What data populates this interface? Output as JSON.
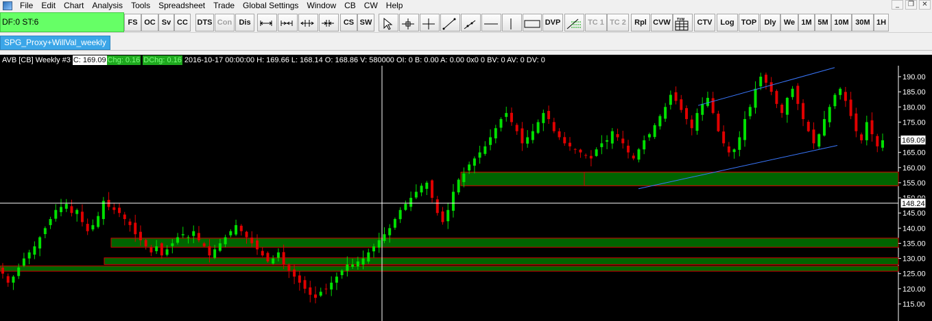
{
  "menu": [
    "File",
    "Edit",
    "Chart",
    "Analysis",
    "Tools",
    "Spreadsheet",
    "Trade",
    "Global Settings",
    "Window",
    "CB",
    "CW",
    "Help"
  ],
  "window_controls": [
    "_",
    "❐",
    "✕"
  ],
  "toolbar": {
    "df_status": "DF:0  ST:6",
    "buttons": [
      {
        "label": "FS"
      },
      {
        "label": "OC"
      },
      {
        "label": "Sv"
      },
      {
        "label": "CC"
      },
      {
        "label": "DTS"
      },
      {
        "label": "Con",
        "disabled": true
      },
      {
        "label": "Dis"
      },
      {
        "label": "CS"
      },
      {
        "label": "SW"
      },
      {
        "label": "DVP"
      },
      {
        "label": "TC 1",
        "disabled": true
      },
      {
        "label": "TC 2",
        "disabled": true
      },
      {
        "label": "Rpl"
      },
      {
        "label": "CVW"
      },
      {
        "label": "CTV"
      },
      {
        "label": "Log"
      },
      {
        "label": "TOP"
      },
      {
        "label": "Dly"
      },
      {
        "label": "We"
      },
      {
        "label": "1M"
      },
      {
        "label": "5M"
      },
      {
        "label": "10M"
      },
      {
        "label": "30M"
      },
      {
        "label": "1H"
      }
    ]
  },
  "tab": {
    "label": "SPG_Proxy+WillVal_weekly"
  },
  "info": {
    "symbol": "AVB [CB]  Weekly  #3",
    "close": "C: 169.09",
    "chg": "Chg: 0.16",
    "dchg": "DChg: 0.16",
    "rest": "2016-10-17 00:00:00  H: 169.66  L: 168.14  O: 168.86  V: 580000  OI: 0  B: 0.00  A: 0.00  0x0  0  BV: 0  AV: 0  DV: 0"
  },
  "colors": {
    "up": "#00e000",
    "down": "#e00000",
    "zone_fill": "#006400",
    "zone_border": "#d00000",
    "trendline": "#3a78ff",
    "crosshair": "#ffffff"
  },
  "chart_data": {
    "type": "candlestick",
    "ylim": [
      115,
      193
    ],
    "y_ticks": [
      "190.00",
      "185.00",
      "180.00",
      "175.00",
      "170.00",
      "165.00",
      "160.00",
      "155.00",
      "150.00",
      "145.00",
      "140.00",
      "135.00",
      "130.00",
      "125.00",
      "120.00",
      "115.00"
    ],
    "last_price_label": "169.09",
    "crosshair_price_label": "148.24",
    "crosshair_price": 148.24,
    "last_price": 169.09,
    "close_path": [
      125,
      122,
      124,
      127,
      130,
      132,
      134,
      137,
      140,
      143,
      146,
      147,
      148,
      145,
      146,
      142,
      139,
      141,
      144,
      149,
      147,
      146,
      145,
      143,
      141,
      138,
      136,
      134,
      132,
      134,
      131,
      133,
      135,
      137,
      138,
      137,
      139,
      136,
      134,
      131,
      133,
      135,
      137,
      139,
      141,
      139,
      137,
      135,
      133,
      131,
      129,
      130,
      132,
      128,
      126,
      124,
      122,
      120,
      118,
      117,
      119,
      120,
      122,
      124,
      126,
      128,
      128,
      129,
      130,
      132,
      134,
      136,
      138,
      140,
      143,
      146,
      148,
      150,
      152,
      154,
      155,
      150,
      145,
      142,
      146,
      152,
      156,
      158,
      161,
      163,
      165,
      167,
      170,
      173,
      176,
      178,
      175,
      172,
      168,
      170,
      172,
      175,
      178,
      176,
      172,
      170,
      168,
      167,
      166,
      165,
      164,
      163,
      166,
      168,
      169,
      172,
      170,
      168,
      165,
      163,
      166,
      169,
      171,
      174,
      177,
      180,
      184,
      182,
      179,
      176,
      173,
      178,
      181,
      183,
      178,
      172,
      168,
      165,
      166,
      170,
      176,
      180,
      186,
      190,
      188,
      185,
      181,
      178,
      183,
      186,
      181,
      176,
      172,
      168,
      171,
      176,
      180,
      184,
      186,
      182,
      177,
      172,
      169,
      175,
      171,
      167,
      169
    ],
    "zones": [
      {
        "x1": 672,
        "x2": 1359,
        "y1": 158.5,
        "y2": 154.0
      },
      {
        "x1": 852,
        "x2": 1359,
        "y1": 158.5,
        "y2": 154.0
      },
      {
        "x1": 162,
        "x2": 1359,
        "y1": 136.7,
        "y2": 133.7
      },
      {
        "x1": 152,
        "x2": 1359,
        "y1": 130.2,
        "y2": 128.0
      },
      {
        "x1": 0,
        "x2": 1359,
        "y1": 127.5,
        "y2": 125.8
      }
    ],
    "trendlines": [
      {
        "x1": 1018,
        "y1": 180.5,
        "x2": 1217,
        "y2": 193.0
      },
      {
        "x1": 931,
        "y1": 153.0,
        "x2": 1221,
        "y2": 167.3
      }
    ]
  }
}
